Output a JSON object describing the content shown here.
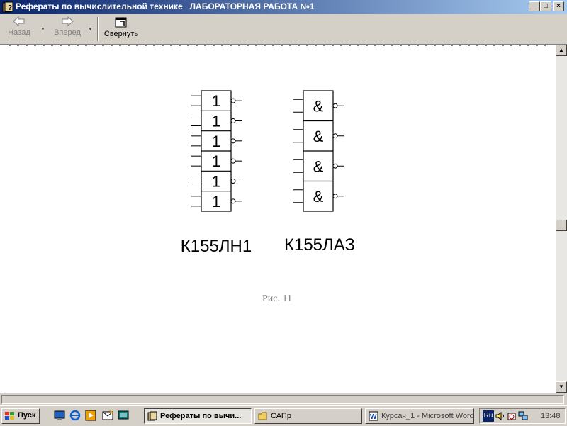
{
  "window": {
    "title": "Рефераты по вычислительной технике   ЛАБОРАТОРНАЯ РАБОТА №1",
    "buttons": {
      "minimize": "_",
      "maximize": "□",
      "close": "×"
    }
  },
  "toolbar": {
    "back_label": "Назад",
    "forward_label": "Вперед",
    "collapse_label": "Свернуть"
  },
  "figure": {
    "chip1_label": "К155ЛН1",
    "chip2_label": "К155ЛАЗ",
    "inverter_symbol": "1",
    "nand_symbol": "&",
    "inverter_count": 6,
    "nand_count": 4,
    "caption": "Рис. 11"
  },
  "taskbar": {
    "start_label": "Пуск",
    "tasks": [
      {
        "label": "Рефераты по вычи...",
        "icon": "help-book-icon"
      },
      {
        "label": "САПр",
        "icon": "folder-icon"
      },
      {
        "label": "Курсач_1 - Microsoft Word",
        "icon": "word-icon"
      }
    ],
    "language": "Ru",
    "clock": "13:48"
  },
  "colors": {
    "title_gradient_start": "#0a246a",
    "title_gradient_end": "#a6caf0",
    "chrome": "#d4d0c8",
    "caption_text": "#808080"
  }
}
